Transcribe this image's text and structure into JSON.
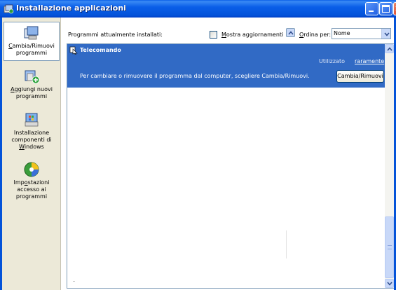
{
  "window": {
    "title": "Installazione applicazioni",
    "buttons": {
      "minimize": "minimize-icon",
      "maximize": "maximize-icon",
      "close": "close-icon"
    }
  },
  "sidebar": {
    "items": [
      {
        "label_mnemonic": "C",
        "label_rest": "ambia/Rimuovi",
        "label_line2": "programmi",
        "icon": "change-remove-icon",
        "active": true
      },
      {
        "label_mnemonic": "A",
        "label_rest": "ggiungi nuovi",
        "label_line2": "programmi",
        "icon": "add-programs-icon",
        "active": false
      },
      {
        "label_line1": "Installazione",
        "label_line2": "componenti di",
        "label_mnemonic": "W",
        "label_rest": "indows",
        "icon": "windows-components-icon",
        "active": false
      },
      {
        "label_prefix": "Imp",
        "label_mnemonic": "o",
        "label_rest": "stazioni",
        "label_line2": "accesso ai",
        "label_line3": "programmi",
        "icon": "program-access-icon",
        "active": false
      }
    ]
  },
  "header": {
    "installed_label": "Programmi attualmente installati:",
    "show_updates_mnemonic": "M",
    "show_updates_rest": "ostra aggiornamenti",
    "show_updates_checked": false,
    "sort_mnemonic": "O",
    "sort_rest": "rdina per:",
    "sort_value": "Nome"
  },
  "programs": [
    {
      "name": "Telecomando",
      "used_label": "Utilizzato",
      "used_value": "raramente",
      "description": "Per cambiare o rimuovere il programma dal computer, scegliere Cambia/Rimuovi.",
      "button": "Cambia/Rimuovi",
      "selected": true
    }
  ],
  "colors": {
    "titlebar": "#0a5ee8",
    "selection": "#316ac5",
    "sidebar": "#ece9d8",
    "border": "#7f9db9"
  }
}
